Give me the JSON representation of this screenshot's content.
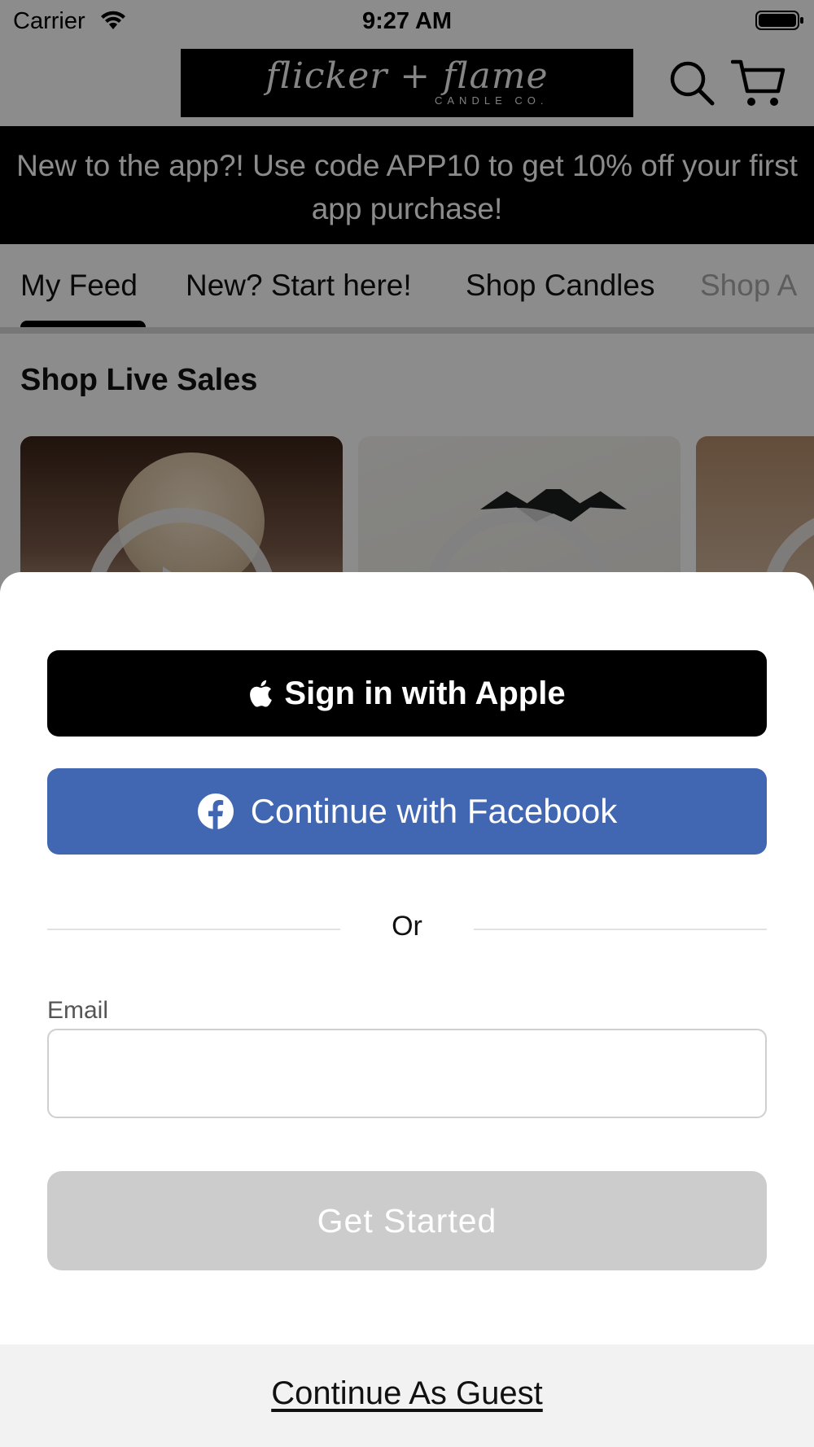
{
  "status_bar": {
    "carrier": "Carrier",
    "time": "9:27 AM",
    "wifi_icon": "wifi-icon",
    "battery_icon": "battery-icon"
  },
  "header": {
    "logo_text": "flicker + flame",
    "logo_subtext": "CANDLE CO.",
    "search_icon": "search-icon",
    "cart_icon": "cart-icon"
  },
  "promo_banner": {
    "text": "New to the app?! Use code APP10 to get 10% off your first app purchase!"
  },
  "tabs": [
    {
      "label": "My Feed",
      "selected": true
    },
    {
      "label": "New? Start here!",
      "selected": false
    },
    {
      "label": "Shop Candles",
      "selected": false
    },
    {
      "label": "Shop A",
      "selected": false
    }
  ],
  "feed": {
    "section_title": "Shop Live Sales"
  },
  "sheet": {
    "apple_button_label": "Sign in with Apple",
    "facebook_button_label": "Continue with Facebook",
    "divider_text": "Or",
    "email_label": "Email",
    "email_value": "",
    "email_placeholder": "",
    "get_started_label": "Get Started",
    "guest_link_label": "Continue As Guest"
  },
  "colors": {
    "facebook_blue": "#4267b2",
    "apple_black": "#000000",
    "disabled_gray": "#cccccc",
    "guest_bar_bg": "#f2f2f2"
  }
}
